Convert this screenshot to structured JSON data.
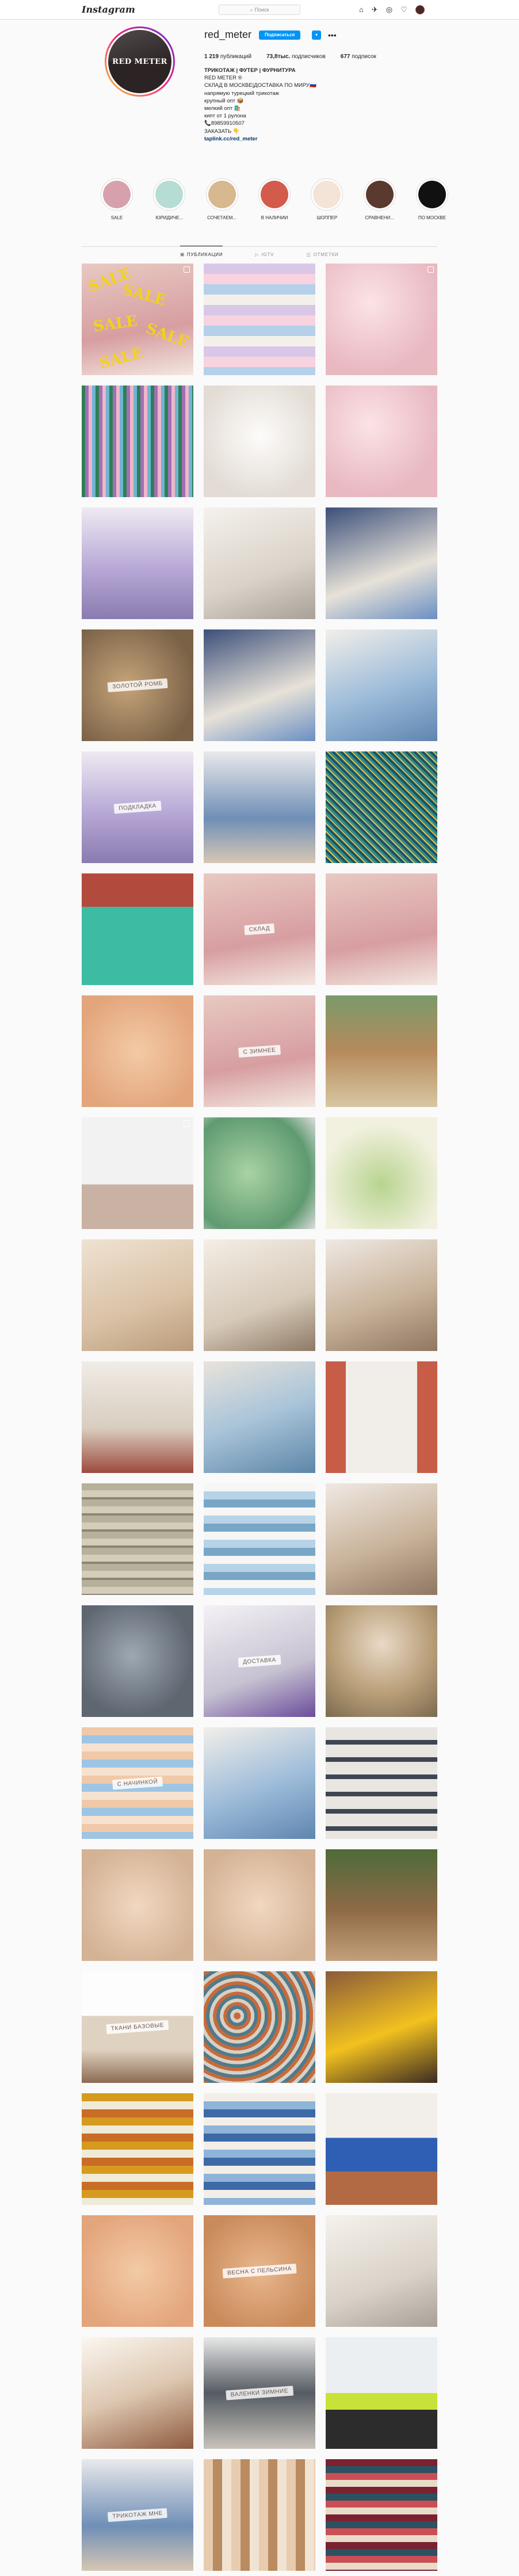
{
  "app": {
    "logo_text": "Instagram",
    "search_placeholder": "Поиск",
    "nav_icons": [
      "home-icon",
      "direct-icon",
      "explore-icon",
      "heart-icon",
      "profile-avatar"
    ]
  },
  "profile": {
    "avatar_text": "RED METER",
    "username": "red_meter",
    "subscribe_label": "Подписаться",
    "chevron": "▾",
    "more": "•••",
    "stats": [
      {
        "value": "1 219",
        "label": "публикаций"
      },
      {
        "value": "73,8тыс.",
        "label": "подписчиков"
      },
      {
        "value": "677",
        "label": "подписок"
      }
    ],
    "bio": {
      "name": "ТРИКОТАЖ | ФУТЕР | ФУРНИТУРА",
      "lines": [
        "RED METER ®",
        "СКЛАД В МОСКВЕ|ДОСТАВКА ПО МИРУ🇷🇺",
        "напрямую турецкий трикотаж",
        "крупный опт 📦",
        "мелкий опт 🛍️",
        "кипт от 1 рулона",
        "📞89859910507",
        "ЗАКАЗАТЬ 👇"
      ],
      "link": "taplink.cc/red_meter"
    }
  },
  "highlights": [
    {
      "label": "SALE",
      "color": "#d6a1ad"
    },
    {
      "label": "ЮРИДИЧЕ...",
      "color": "#b7dcd4"
    },
    {
      "label": "СОЧЕТАЕМ...",
      "color": "#d7b88f"
    },
    {
      "label": "В НАЛИЧИИ",
      "color": "#d35b4c"
    },
    {
      "label": "ШОППЕР",
      "color": "#f3e4d7"
    },
    {
      "label": "СРАВНЕНИ...",
      "color": "#5a3a2e"
    },
    {
      "label": "ПО МОСКВЕ",
      "color": "#111111"
    }
  ],
  "tabs": [
    {
      "icon": "⊞",
      "label": "ПУБЛИКАЦИИ",
      "active": true
    },
    {
      "icon": "▷",
      "label": "IGTV",
      "active": false
    },
    {
      "icon": "◫",
      "label": "ОТМЕТКИ",
      "active": false
    }
  ],
  "posts": [
    {
      "texture": "t-rose",
      "badge": "reel",
      "caption": "",
      "sale": true
    },
    {
      "texture": "t-folds",
      "badge": "",
      "caption": "",
      "sale": false
    },
    {
      "texture": "t-pink",
      "badge": "reel",
      "caption": "",
      "sale": false
    },
    {
      "texture": "t-stripes",
      "badge": "",
      "caption": "",
      "sale": false
    },
    {
      "texture": "t-white",
      "badge": "",
      "caption": "",
      "sale": false
    },
    {
      "texture": "t-pink",
      "badge": "",
      "caption": "",
      "sale": false
    },
    {
      "texture": "t-lilac",
      "badge": "",
      "caption": "",
      "sale": false
    },
    {
      "texture": "t-lounge",
      "badge": "",
      "caption": "",
      "sale": false
    },
    {
      "texture": "t-navy",
      "badge": "",
      "caption": "",
      "sale": false
    },
    {
      "texture": "t-sand",
      "badge": "",
      "caption": "ЗОЛОТОЙ РОМБ",
      "sale": false
    },
    {
      "texture": "t-navy",
      "badge": "",
      "caption": "",
      "sale": false
    },
    {
      "texture": "t-sky",
      "badge": "",
      "caption": "",
      "sale": false
    },
    {
      "texture": "t-lilac",
      "badge": "",
      "caption": "ПОДКЛАДКА",
      "sale": false
    },
    {
      "texture": "t-jeans",
      "badge": "",
      "caption": "",
      "sale": false
    },
    {
      "texture": "t-knit",
      "badge": "",
      "caption": "",
      "sale": false
    },
    {
      "texture": "t-teal",
      "badge": "",
      "caption": "",
      "sale": false
    },
    {
      "texture": "t-rose",
      "badge": "",
      "caption": "СКЛАД",
      "sale": false
    },
    {
      "texture": "t-rose",
      "badge": "",
      "caption": "",
      "sale": false
    },
    {
      "texture": "t-peachy",
      "badge": "",
      "caption": "",
      "sale": false
    },
    {
      "texture": "t-rose",
      "badge": "",
      "caption": "С ЗИМНЕЕ",
      "sale": false
    },
    {
      "texture": "t-alpaca",
      "badge": "",
      "caption": "",
      "sale": false
    },
    {
      "texture": "t-laptop",
      "badge": "reel",
      "caption": "",
      "sale": false
    },
    {
      "texture": "t-mint",
      "badge": "",
      "caption": "",
      "sale": false
    },
    {
      "texture": "t-matcha",
      "badge": "",
      "caption": "",
      "sale": false
    },
    {
      "texture": "t-beige",
      "badge": "",
      "caption": "",
      "sale": false
    },
    {
      "texture": "t-stone",
      "badge": "",
      "caption": "",
      "sale": false
    },
    {
      "texture": "t-camel",
      "badge": "",
      "caption": "",
      "sale": false
    },
    {
      "texture": "t-bag",
      "badge": "",
      "caption": "",
      "sale": false
    },
    {
      "texture": "t-spool",
      "badge": "",
      "caption": "",
      "sale": false
    },
    {
      "texture": "t-brick",
      "badge": "",
      "caption": "",
      "sale": false
    },
    {
      "texture": "t-stack",
      "badge": "",
      "caption": "",
      "sale": false
    },
    {
      "texture": "t-blue",
      "badge": "",
      "caption": "",
      "sale": false
    },
    {
      "texture": "t-camel",
      "badge": "",
      "caption": "",
      "sale": false
    },
    {
      "texture": "t-grey",
      "badge": "",
      "caption": "",
      "sale": false
    },
    {
      "texture": "t-purple",
      "badge": "",
      "caption": "ДОСТАВКА",
      "sale": false
    },
    {
      "texture": "t-camo",
      "badge": "",
      "caption": "",
      "sale": false
    },
    {
      "texture": "t-peach",
      "badge": "",
      "caption": "С НАЧИНКОЙ",
      "sale": false
    },
    {
      "texture": "t-sky",
      "badge": "",
      "caption": "",
      "sale": false
    },
    {
      "texture": "t-belts",
      "badge": "",
      "caption": "",
      "sale": false
    },
    {
      "texture": "t-nude",
      "badge": "",
      "caption": "",
      "sale": false
    },
    {
      "texture": "t-nude",
      "badge": "",
      "caption": "",
      "sale": false
    },
    {
      "texture": "t-forest",
      "badge": "",
      "caption": "",
      "sale": false
    },
    {
      "texture": "t-table",
      "badge": "",
      "caption": "ТКАНИ БАЗОВЫЕ",
      "sale": false
    },
    {
      "texture": "t-leaves",
      "badge": "",
      "caption": "",
      "sale": false
    },
    {
      "texture": "t-yellow",
      "badge": "",
      "caption": "",
      "sale": false
    },
    {
      "texture": "t-mustard",
      "badge": "",
      "caption": "",
      "sale": false
    },
    {
      "texture": "t-denim",
      "badge": "",
      "caption": "",
      "sale": false
    },
    {
      "texture": "t-cobalt",
      "badge": "",
      "caption": "",
      "sale": false
    },
    {
      "texture": "t-peachy",
      "badge": "",
      "caption": "",
      "sale": false
    },
    {
      "texture": "t-apricot",
      "badge": "",
      "caption": "ВЕСНА С ПЕЛЬСИНА",
      "sale": false
    },
    {
      "texture": "t-lounge",
      "badge": "",
      "caption": "",
      "sale": false
    },
    {
      "texture": "t-craft",
      "badge": "",
      "caption": "",
      "sale": false
    },
    {
      "texture": "t-coat",
      "badge": "",
      "caption": "ВАЛЕНКИ ЗИМНИЕ",
      "sale": false
    },
    {
      "texture": "t-lime",
      "badge": "",
      "caption": "",
      "sale": false
    },
    {
      "texture": "t-jeans",
      "badge": "",
      "caption": "ТРИКОТАЖ МНЕ",
      "sale": false
    },
    {
      "texture": "t-cones",
      "badge": "",
      "caption": "",
      "sale": false
    },
    {
      "texture": "t-wine",
      "badge": "",
      "caption": "",
      "sale": false
    }
  ]
}
